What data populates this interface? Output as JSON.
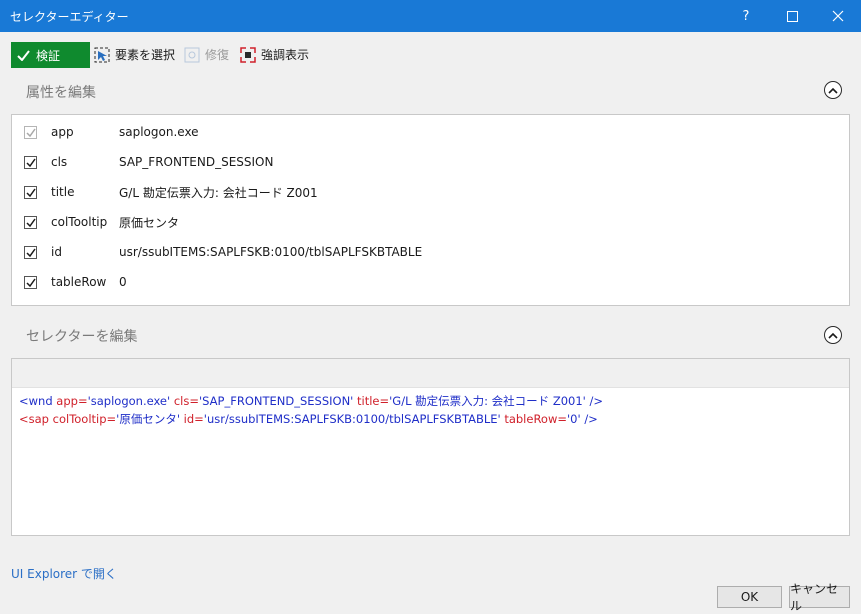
{
  "window": {
    "title": "セレクターエディター",
    "help_label": "?",
    "maximize_label": "☐",
    "close_label": "✕"
  },
  "toolbar": {
    "validate_label": "検証",
    "select_element_label": "要素を選択",
    "repair_label": "修復",
    "highlight_label": "強調表示"
  },
  "attributes_section": {
    "title": "属性を編集",
    "rows": [
      {
        "name": "app",
        "value": "saplogon.exe",
        "checked": true,
        "disabled": true
      },
      {
        "name": "cls",
        "value": "SAP_FRONTEND_SESSION",
        "checked": true,
        "disabled": false
      },
      {
        "name": "title",
        "value": "G/L 勘定伝票入力: 会社コード Z001",
        "checked": true,
        "disabled": false
      },
      {
        "name": "colTooltip",
        "value": "原価センタ",
        "checked": true,
        "disabled": false
      },
      {
        "name": "id",
        "value": "usr/ssubITEMS:SAPLFSKB:0100/tblSAPLFSKBTABLE",
        "checked": true,
        "disabled": false
      },
      {
        "name": "tableRow",
        "value": "0",
        "checked": true,
        "disabled": false
      }
    ]
  },
  "selector_section": {
    "title": "セレクターを編集",
    "line1": {
      "open": "<wnd ",
      "a1": "app=",
      "v1": "'saplogon.exe' ",
      "a2": "cls=",
      "v2": "'SAP_FRONTEND_SESSION' ",
      "a3": "title=",
      "v3": "'G/L 勘定伝票入力: 会社コード Z001' ",
      "close": "/>"
    },
    "line2": {
      "open": "<sap ",
      "a1": "colTooltip=",
      "v1": "'原価センタ' ",
      "a2": "id=",
      "v2": "'usr/ssubITEMS:SAPLFSKB:0100/tblSAPLFSKBTABLE' ",
      "a3": "tableRow=",
      "v3": "'0' ",
      "close": "/>"
    }
  },
  "footer": {
    "explorer_link": "UI Explorer で開く",
    "ok_label": "OK",
    "cancel_label": "キャンセル"
  },
  "colors": {
    "titlebar": "#1979d6",
    "validate": "#0f8a2e",
    "tag": "#1f2ec8",
    "attr_name": "#d0202a",
    "link": "#2b6fc6"
  }
}
